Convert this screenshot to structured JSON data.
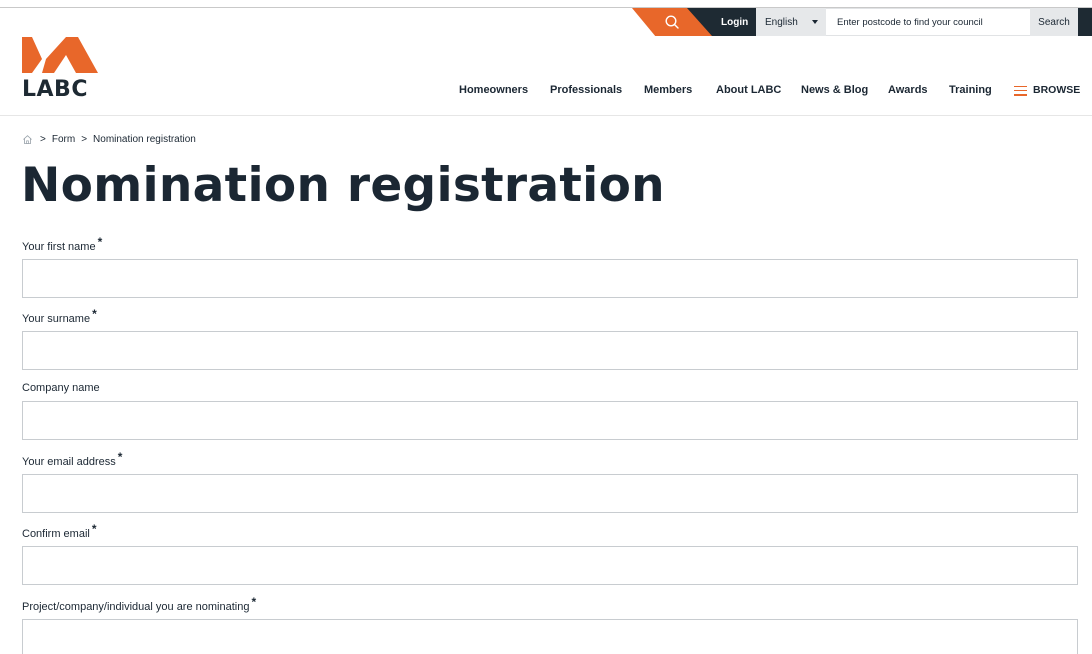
{
  "utility": {
    "search_icon": "search-icon",
    "login_label": "Login",
    "language_selected": "English",
    "postcode_placeholder": "Enter postcode to find your council",
    "postcode_button": "Search"
  },
  "brand": {
    "logo_text": "LABC",
    "accent_color": "#e8672a",
    "dark_color": "#1e2a33"
  },
  "nav": {
    "items": [
      {
        "label": "Homeowners"
      },
      {
        "label": "Professionals"
      },
      {
        "label": "Members"
      },
      {
        "label": "About LABC"
      },
      {
        "label": "News & Blog"
      },
      {
        "label": "Awards"
      },
      {
        "label": "Training"
      }
    ],
    "browse_label": "BROWSE"
  },
  "breadcrumb": {
    "home_icon": "home-icon",
    "separator": ">",
    "items": [
      "Form",
      "Nomination registration"
    ]
  },
  "page": {
    "title": "Nomination registration"
  },
  "form": {
    "fields": [
      {
        "label": "Your first name",
        "required": true,
        "required_mark": "*",
        "value": ""
      },
      {
        "label": "Your surname",
        "required": true,
        "required_mark": "*",
        "value": ""
      },
      {
        "label": "Company name",
        "required": false,
        "required_mark": "",
        "value": ""
      },
      {
        "label": "Your email address",
        "required": true,
        "required_mark": "*",
        "value": ""
      },
      {
        "label": "Confirm email",
        "required": true,
        "required_mark": "*",
        "value": ""
      },
      {
        "label": "Project/company/individual you are nominating",
        "required": true,
        "required_mark": "*",
        "value": ""
      }
    ]
  }
}
